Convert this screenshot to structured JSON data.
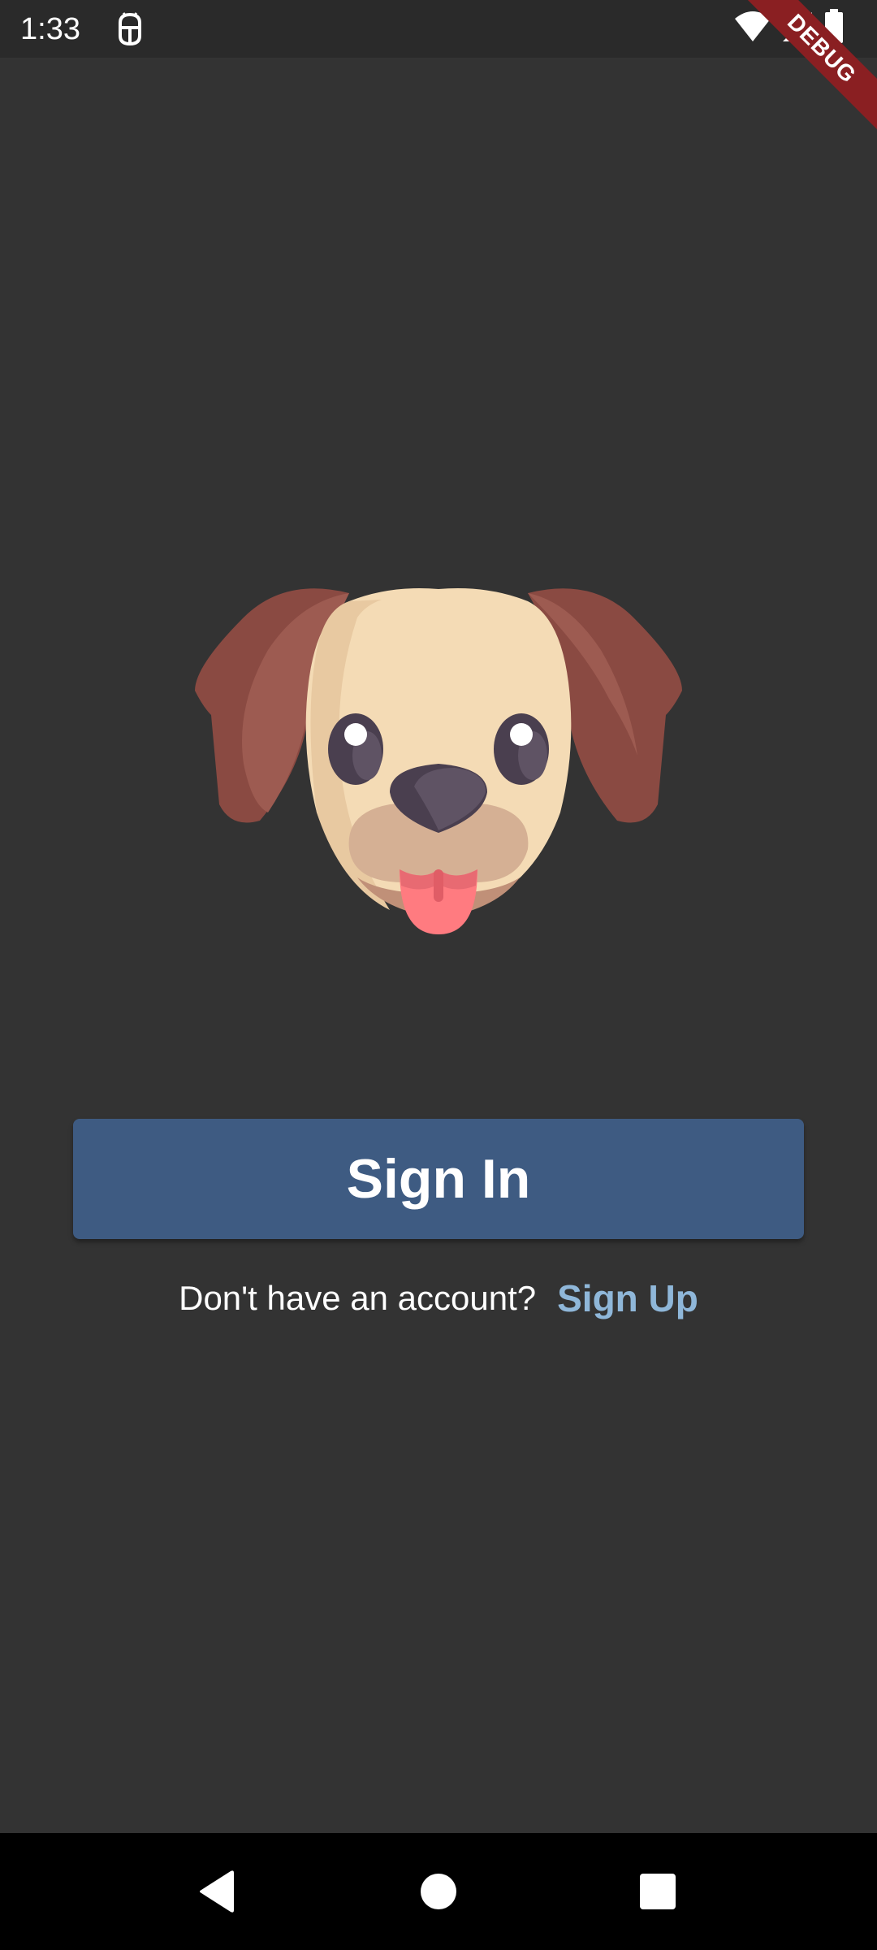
{
  "status_bar": {
    "time": "1:33",
    "app_icon": "android-debug-icon",
    "icons": [
      "wifi-icon",
      "signal-icon",
      "battery-icon"
    ]
  },
  "debug_banner": {
    "label": "DEBUG",
    "color": "#8a1f22"
  },
  "illustration": {
    "icon": "dog-face-icon"
  },
  "signin": {
    "label": "Sign In",
    "color": "#3e5b82"
  },
  "signup": {
    "prompt": "Don't have an account?",
    "link_label": "Sign Up",
    "link_color": "#8fb7d9"
  },
  "nav_bar": {
    "icons": [
      "back-icon",
      "home-icon",
      "recents-icon"
    ]
  },
  "colors": {
    "background": "#333333",
    "status_bar": "#2a2a2a",
    "nav_bar": "#000000"
  }
}
